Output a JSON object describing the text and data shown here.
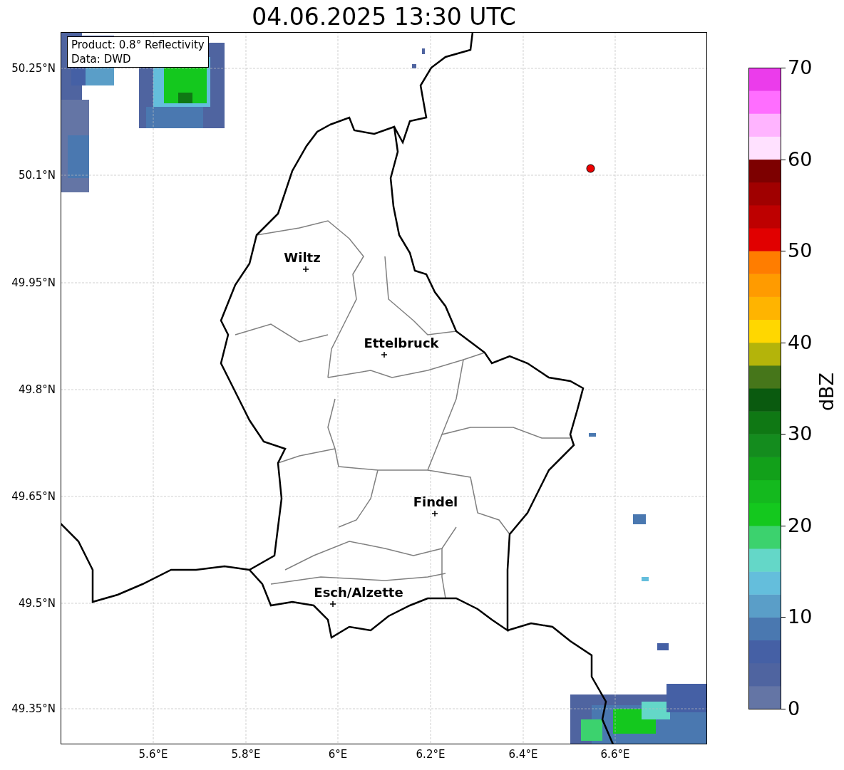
{
  "title": "04.06.2025 13:30 UTC",
  "legend": [
    "Product: 0.8° Reflectivity",
    "Data: DWD"
  ],
  "y_ticks": [
    "50.25°N",
    "50.1°N",
    "49.95°N",
    "49.8°N",
    "49.65°N",
    "49.5°N",
    "49.35°N"
  ],
  "x_ticks": [
    "5.6°E",
    "5.8°E",
    "6°E",
    "6.2°E",
    "6.4°E",
    "6.6°E"
  ],
  "places": [
    {
      "name": "Wiltz"
    },
    {
      "name": "Ettelbruck"
    },
    {
      "name": "Findel"
    },
    {
      "name": "Esch/Alzette"
    }
  ],
  "colorbar": {
    "label": "dBZ",
    "ticks": [
      "70",
      "60",
      "50",
      "40",
      "30",
      "20",
      "10",
      "0"
    ]
  }
}
